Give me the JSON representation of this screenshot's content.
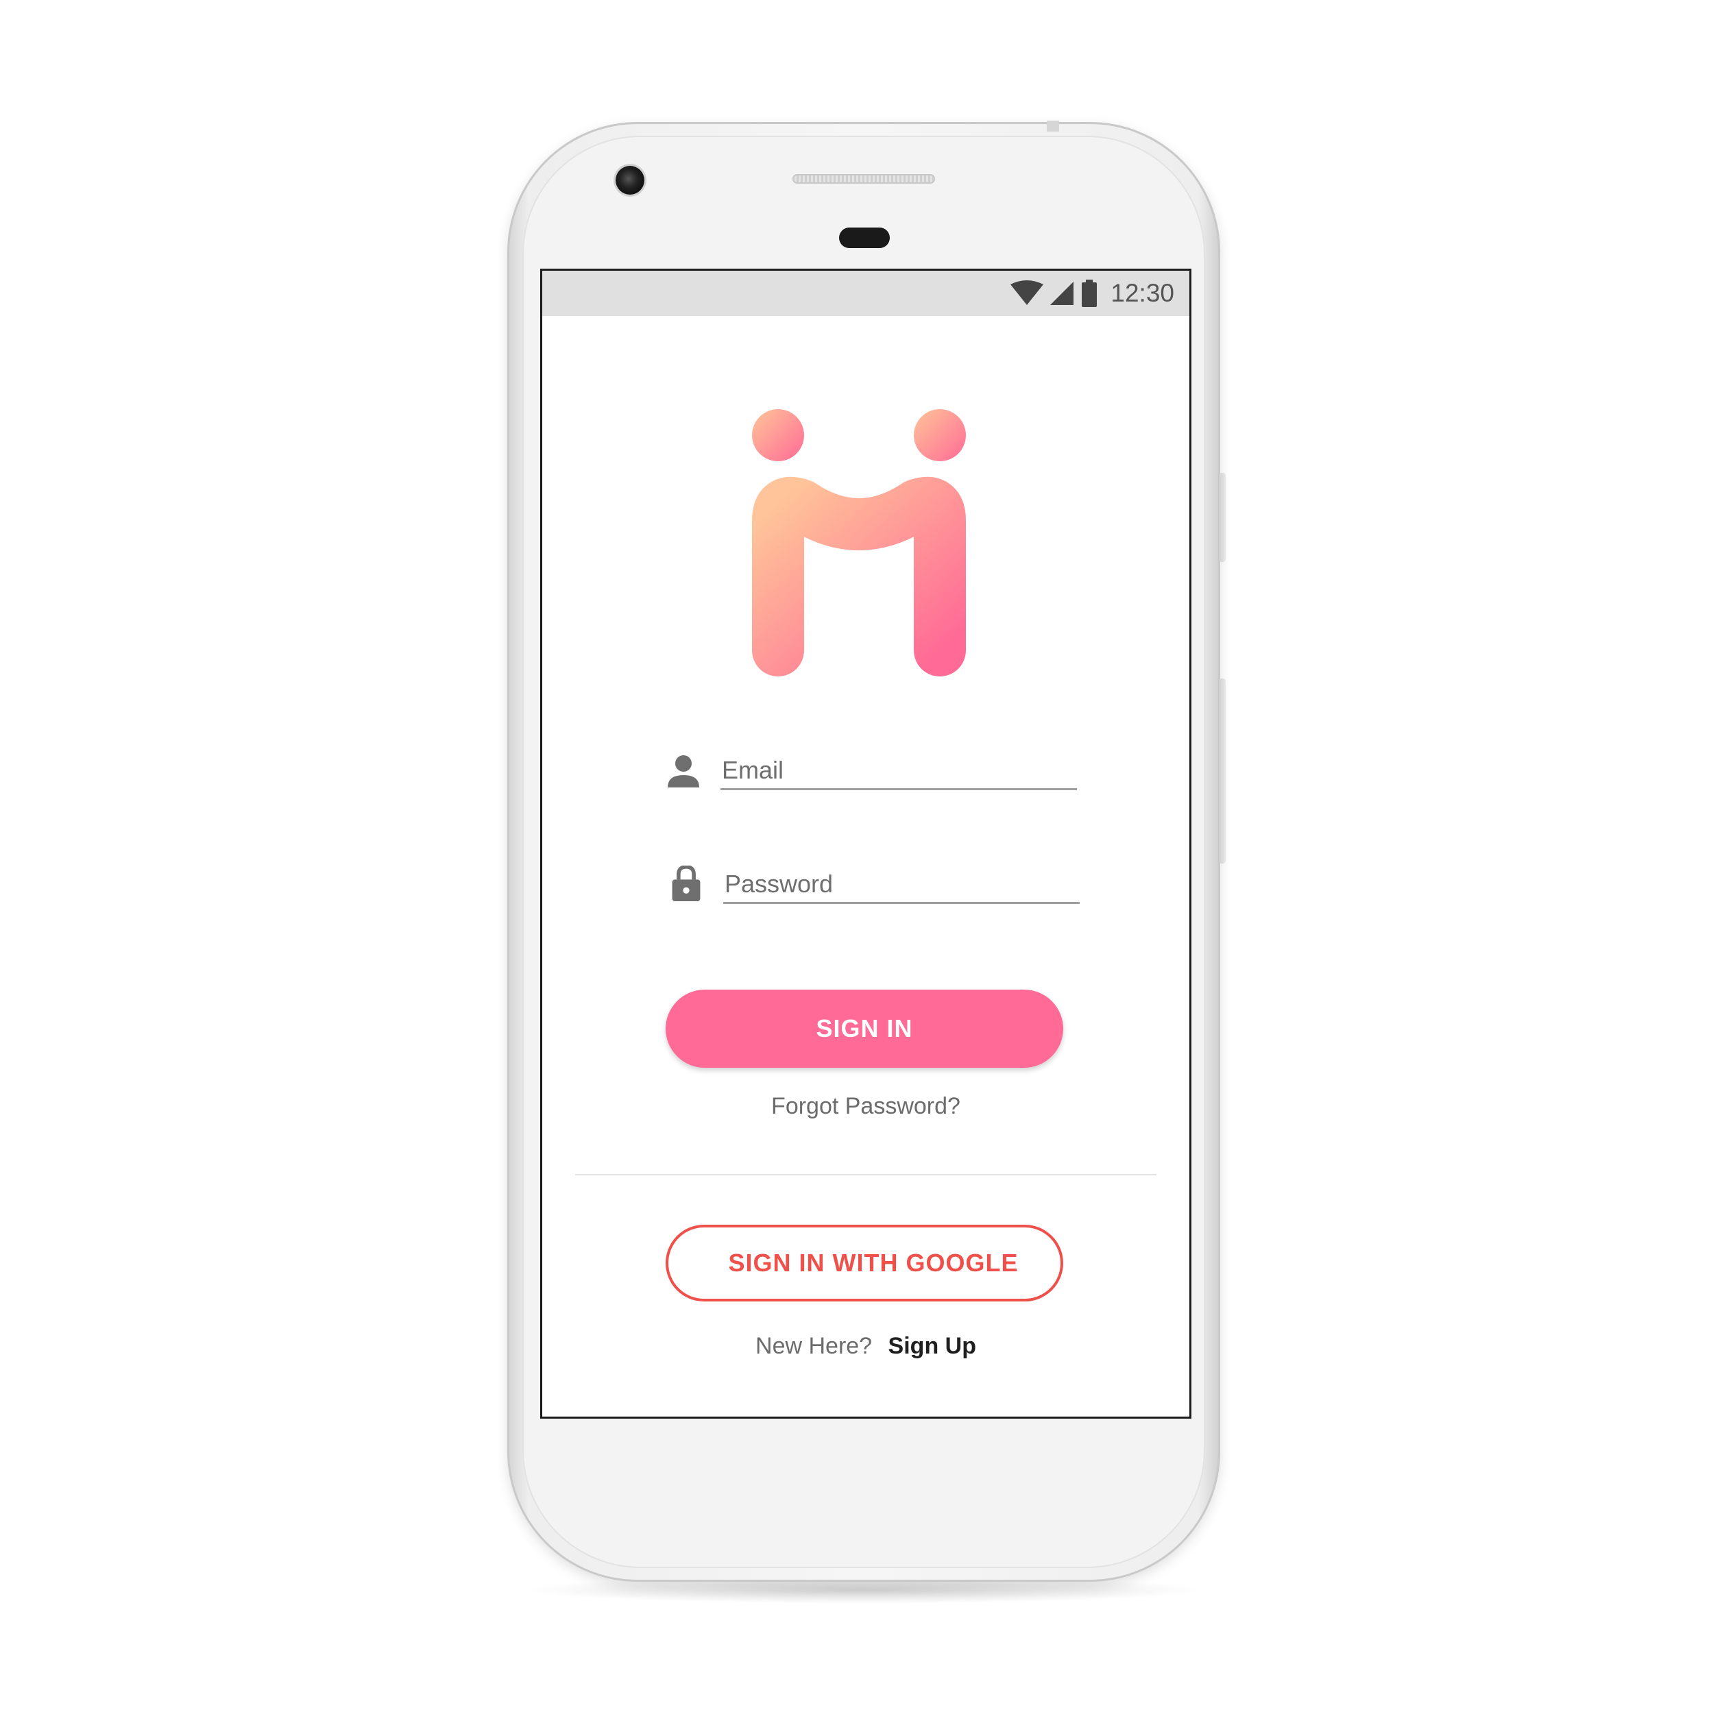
{
  "status_bar": {
    "time": "12:30",
    "icons": [
      "wifi-icon",
      "signal-icon",
      "battery-icon"
    ]
  },
  "login": {
    "email_placeholder": "Email",
    "email_value": "",
    "password_placeholder": "Password",
    "password_value": "",
    "sign_in_label": "SIGN IN",
    "forgot_password_label": "Forgot Password?",
    "google_sign_in_label": "SIGN IN WITH GOOGLE",
    "new_here_text": "New Here?",
    "sign_up_label": "Sign Up"
  },
  "colors": {
    "primary": "#ff6b96",
    "google_accent": "#f0504a",
    "logo_gradient_start": "#ffc499",
    "logo_gradient_end": "#ff6b96",
    "status_bar_bg": "#e0e0e0"
  }
}
